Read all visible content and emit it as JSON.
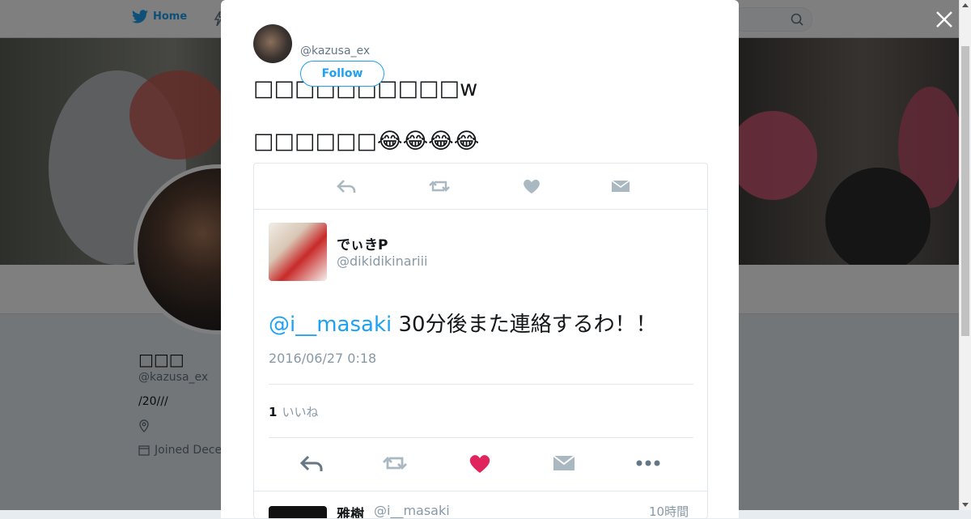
{
  "nav": {
    "home_label": "Home"
  },
  "profile": {
    "name": "□□□",
    "handle": "@kazusa_ex",
    "bio": "/20///",
    "joined": "Joined Dece"
  },
  "modal": {
    "handle": "@kazusa_ex",
    "follow_label": "Follow",
    "tweet_line1": "□□□□□□□□□□w",
    "tweet_line2": "□□□□□□😂😂😂😂"
  },
  "quoted": {
    "name": "でぃきP",
    "handle": "@dikidikinariii",
    "mention": "@i__masaki",
    "text": " 30分後また連絡するわ！！",
    "date": "2016/06/27 0:18",
    "like_count": "1",
    "like_label": "いいね"
  },
  "next": {
    "name": "雅樹",
    "handle": "@i__masaki",
    "time": "10時間"
  },
  "colors": {
    "accent": "#1da1f2",
    "like": "#e0245e"
  }
}
